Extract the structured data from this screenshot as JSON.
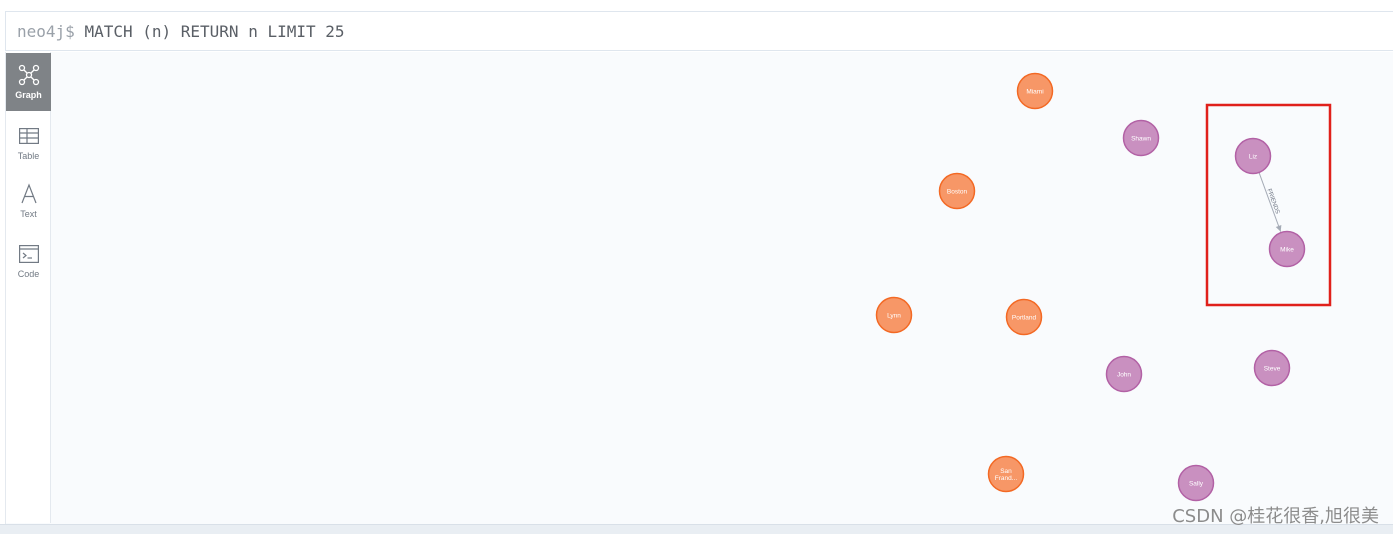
{
  "query": {
    "prompt": "neo4j$",
    "text": "MATCH (n) RETURN n LIMIT 25"
  },
  "sidebar": {
    "items": [
      {
        "label": "Graph",
        "icon": "graph-icon",
        "active": true
      },
      {
        "label": "Table",
        "icon": "table-icon",
        "active": false
      },
      {
        "label": "Text",
        "icon": "text-icon",
        "active": false
      },
      {
        "label": "Code",
        "icon": "code-icon",
        "active": false
      }
    ]
  },
  "graph": {
    "colors": {
      "city_fill": "#f79767",
      "city_stroke": "#f36924",
      "person_fill": "#c990c0",
      "person_stroke": "#b261a5",
      "highlight": "#e0201b",
      "rel": "#a5abb6"
    },
    "nodes": [
      {
        "id": "miami",
        "label": "Miami",
        "type": "city"
      },
      {
        "id": "boston",
        "label": "Boston",
        "type": "city"
      },
      {
        "id": "lynn",
        "label": "Lynn",
        "type": "city"
      },
      {
        "id": "portland",
        "label": "Portland",
        "type": "city"
      },
      {
        "id": "sanfran",
        "label": "San Frand...",
        "type": "city"
      },
      {
        "id": "shawn",
        "label": "Shawn",
        "type": "person"
      },
      {
        "id": "liz",
        "label": "Liz",
        "type": "person"
      },
      {
        "id": "mike",
        "label": "Mike",
        "type": "person"
      },
      {
        "id": "john",
        "label": "John",
        "type": "person"
      },
      {
        "id": "steve",
        "label": "Steve",
        "type": "person"
      },
      {
        "id": "sally",
        "label": "Sally",
        "type": "person"
      }
    ],
    "relationships": [
      {
        "from": "liz",
        "to": "mike",
        "label": "FRIENDS"
      }
    ]
  },
  "watermark": "CSDN @桂花很香,旭很美"
}
